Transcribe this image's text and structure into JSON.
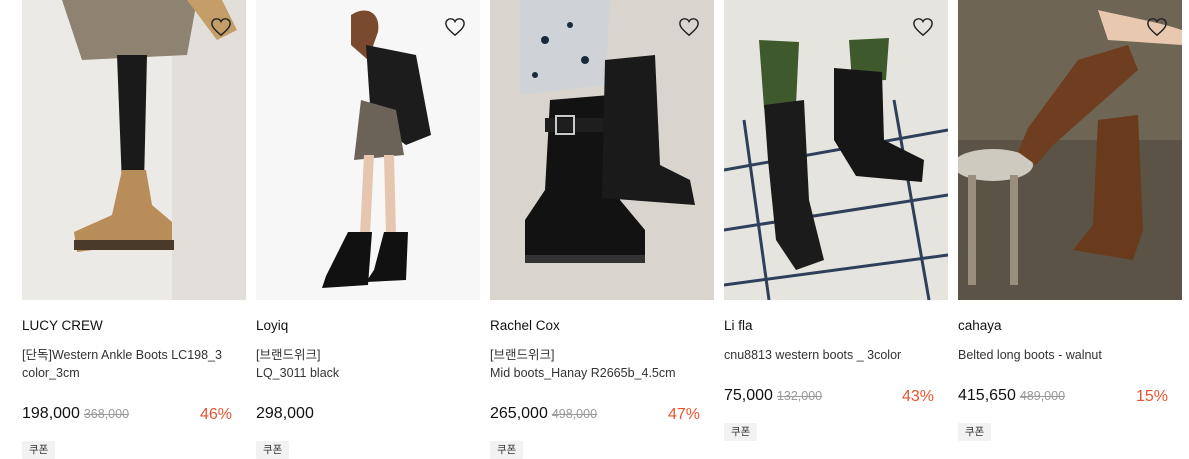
{
  "products": [
    {
      "brand": "LUCY CREW",
      "name_line1": "[단독]Western Ankle Boots LC198_3",
      "name_line2": "color_3cm",
      "price": "198,000",
      "original_price": "368,000",
      "discount": "46%",
      "coupon": "쿠폰",
      "image_label": "tan suede ankle boot"
    },
    {
      "brand": "Loyiq",
      "name_line1": "[브랜드위크]",
      "name_line2": "LQ_3011 black",
      "price": "298,000",
      "original_price": "",
      "discount": "",
      "coupon": "쿠폰",
      "image_label": "model in black leather jacket and boots"
    },
    {
      "brand": "Rachel Cox",
      "name_line1": "[브랜드위크]",
      "name_line2": "Mid boots_Hanay R2665b_4.5cm",
      "price": "265,000",
      "original_price": "498,000",
      "discount": "47%",
      "coupon": "쿠폰",
      "image_label": "black mid boots with buckle strap"
    },
    {
      "brand": "Li fla",
      "name_line1": "cnu8813 western boots _ 3color",
      "name_line2": "",
      "price": "75,000",
      "original_price": "132,000",
      "discount": "43%",
      "coupon": "쿠폰",
      "image_label": "black western boots with green socks"
    },
    {
      "brand": "cahaya",
      "name_line1": "Belted long boots - walnut",
      "name_line2": "",
      "price": "415,650",
      "original_price": "489,000",
      "discount": "15%",
      "coupon": "쿠폰",
      "image_label": "walnut suede long boots"
    }
  ],
  "icons": {
    "wishlist": "heart-outline-icon"
  },
  "colors": {
    "discount": "#e8542e",
    "coupon_bg": "#f2f2f2"
  }
}
